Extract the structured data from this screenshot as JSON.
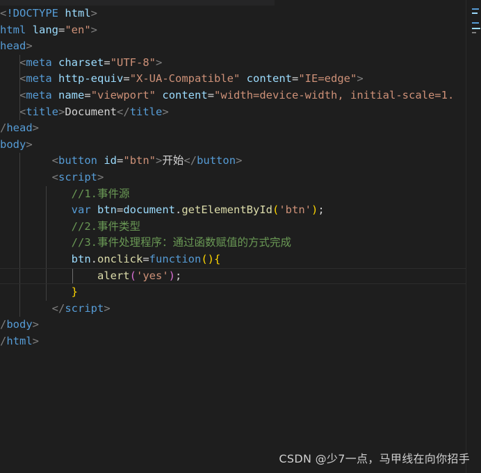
{
  "code_lines": [
    [
      {
        "c": "t-punc",
        "t": "<"
      },
      {
        "c": "t-tag",
        "t": "!DOCTYPE"
      },
      {
        "c": "t-text",
        "t": " "
      },
      {
        "c": "t-attr",
        "t": "html"
      },
      {
        "c": "t-punc",
        "t": ">"
      }
    ],
    [
      {
        "c": "t-tag",
        "t": "html"
      },
      {
        "c": "t-text",
        "t": " "
      },
      {
        "c": "t-attr",
        "t": "lang"
      },
      {
        "c": "t-eq",
        "t": "="
      },
      {
        "c": "t-str",
        "t": "\"en\""
      },
      {
        "c": "t-punc",
        "t": ">"
      }
    ],
    [
      {
        "c": "t-tag",
        "t": "head"
      },
      {
        "c": "t-punc",
        "t": ">"
      }
    ],
    [
      {
        "c": "t-text",
        "t": "   "
      },
      {
        "c": "t-punc",
        "t": "<"
      },
      {
        "c": "t-tag",
        "t": "meta"
      },
      {
        "c": "t-text",
        "t": " "
      },
      {
        "c": "t-attr",
        "t": "charset"
      },
      {
        "c": "t-eq",
        "t": "="
      },
      {
        "c": "t-str",
        "t": "\"UTF-8\""
      },
      {
        "c": "t-punc",
        "t": ">"
      }
    ],
    [
      {
        "c": "t-text",
        "t": "   "
      },
      {
        "c": "t-punc",
        "t": "<"
      },
      {
        "c": "t-tag",
        "t": "meta"
      },
      {
        "c": "t-text",
        "t": " "
      },
      {
        "c": "t-attr",
        "t": "http-equiv"
      },
      {
        "c": "t-eq",
        "t": "="
      },
      {
        "c": "t-str",
        "t": "\"X-UA-Compatible\""
      },
      {
        "c": "t-text",
        "t": " "
      },
      {
        "c": "t-attr",
        "t": "content"
      },
      {
        "c": "t-eq",
        "t": "="
      },
      {
        "c": "t-str",
        "t": "\"IE=edge\""
      },
      {
        "c": "t-punc",
        "t": ">"
      }
    ],
    [
      {
        "c": "t-text",
        "t": "   "
      },
      {
        "c": "t-punc",
        "t": "<"
      },
      {
        "c": "t-tag",
        "t": "meta"
      },
      {
        "c": "t-text",
        "t": " "
      },
      {
        "c": "t-attr",
        "t": "name"
      },
      {
        "c": "t-eq",
        "t": "="
      },
      {
        "c": "t-str",
        "t": "\"viewport\""
      },
      {
        "c": "t-text",
        "t": " "
      },
      {
        "c": "t-attr",
        "t": "content"
      },
      {
        "c": "t-eq",
        "t": "="
      },
      {
        "c": "t-str",
        "t": "\"width=device-width, initial-scale=1."
      }
    ],
    [
      {
        "c": "t-text",
        "t": "   "
      },
      {
        "c": "t-punc",
        "t": "<"
      },
      {
        "c": "t-tag",
        "t": "title"
      },
      {
        "c": "t-punc",
        "t": ">"
      },
      {
        "c": "t-text",
        "t": "Document"
      },
      {
        "c": "t-punc",
        "t": "</"
      },
      {
        "c": "t-tag",
        "t": "title"
      },
      {
        "c": "t-punc",
        "t": ">"
      }
    ],
    [
      {
        "c": "t-punc",
        "t": "/"
      },
      {
        "c": "t-tag",
        "t": "head"
      },
      {
        "c": "t-punc",
        "t": ">"
      }
    ],
    [
      {
        "c": "t-tag",
        "t": "body"
      },
      {
        "c": "t-punc",
        "t": ">"
      }
    ],
    [
      {
        "c": "t-text",
        "t": "        "
      },
      {
        "c": "t-punc",
        "t": "<"
      },
      {
        "c": "t-tag",
        "t": "button"
      },
      {
        "c": "t-text",
        "t": " "
      },
      {
        "c": "t-attr",
        "t": "id"
      },
      {
        "c": "t-eq",
        "t": "="
      },
      {
        "c": "t-str",
        "t": "\"btn\""
      },
      {
        "c": "t-punc",
        "t": ">"
      },
      {
        "c": "t-text",
        "t": "开始"
      },
      {
        "c": "t-punc",
        "t": "</"
      },
      {
        "c": "t-tag",
        "t": "button"
      },
      {
        "c": "t-punc",
        "t": ">"
      }
    ],
    [
      {
        "c": "t-text",
        "t": "        "
      },
      {
        "c": "t-punc",
        "t": "<"
      },
      {
        "c": "t-tag",
        "t": "script"
      },
      {
        "c": "t-punc",
        "t": ">"
      }
    ],
    [
      {
        "c": "t-text",
        "t": "           "
      },
      {
        "c": "t-comment",
        "t": "//1.事件源"
      }
    ],
    [
      {
        "c": "t-text",
        "t": "           "
      },
      {
        "c": "t-kw",
        "t": "var"
      },
      {
        "c": "t-text",
        "t": " "
      },
      {
        "c": "t-var",
        "t": "btn"
      },
      {
        "c": "t-text",
        "t": "="
      },
      {
        "c": "t-var",
        "t": "document"
      },
      {
        "c": "t-text",
        "t": "."
      },
      {
        "c": "t-fn",
        "t": "getElementById"
      },
      {
        "c": "t-br1",
        "t": "("
      },
      {
        "c": "t-str",
        "t": "'btn'"
      },
      {
        "c": "t-br1",
        "t": ")"
      },
      {
        "c": "t-text",
        "t": ";"
      }
    ],
    [
      {
        "c": "t-text",
        "t": "           "
      },
      {
        "c": "t-comment",
        "t": "//2.事件类型"
      }
    ],
    [
      {
        "c": "t-text",
        "t": "           "
      },
      {
        "c": "t-comment",
        "t": "//3.事件处理程序：通过函数赋值的方式完成"
      }
    ],
    [
      {
        "c": "t-text",
        "t": "           "
      },
      {
        "c": "t-var",
        "t": "btn"
      },
      {
        "c": "t-text",
        "t": "."
      },
      {
        "c": "t-fn",
        "t": "onclick"
      },
      {
        "c": "t-text",
        "t": "="
      },
      {
        "c": "t-kw",
        "t": "function"
      },
      {
        "c": "t-br1",
        "t": "()"
      },
      {
        "c": "t-br1",
        "t": "{"
      }
    ],
    [
      {
        "c": "t-text",
        "t": "               "
      },
      {
        "c": "t-fn",
        "t": "alert"
      },
      {
        "c": "t-br2",
        "t": "("
      },
      {
        "c": "t-str",
        "t": "'yes'"
      },
      {
        "c": "t-br2",
        "t": ")"
      },
      {
        "c": "t-text",
        "t": ";"
      }
    ],
    [
      {
        "c": "t-text",
        "t": "           "
      },
      {
        "c": "t-br1",
        "t": "}"
      }
    ],
    [
      {
        "c": "t-text",
        "t": "        "
      },
      {
        "c": "t-punc",
        "t": "</"
      },
      {
        "c": "t-tag",
        "t": "script"
      },
      {
        "c": "t-punc",
        "t": ">"
      }
    ],
    [
      {
        "c": "t-punc",
        "t": "/"
      },
      {
        "c": "t-tag",
        "t": "body"
      },
      {
        "c": "t-punc",
        "t": ">"
      }
    ],
    [
      {
        "c": "t-punc",
        "t": "/"
      },
      {
        "c": "t-tag",
        "t": "html"
      },
      {
        "c": "t-punc",
        "t": ">"
      }
    ]
  ],
  "active_line": 16,
  "watermark": "CSDN @少7一点，马甲线在向你招手",
  "colors": {
    "background": "#1e1e1e",
    "tag": "#569cd6",
    "attribute": "#9cdcfe",
    "string": "#ce9178",
    "comment": "#6a9955",
    "function": "#dcdcaa",
    "bracket_gold": "#ffd700",
    "bracket_purple": "#da70d6"
  }
}
